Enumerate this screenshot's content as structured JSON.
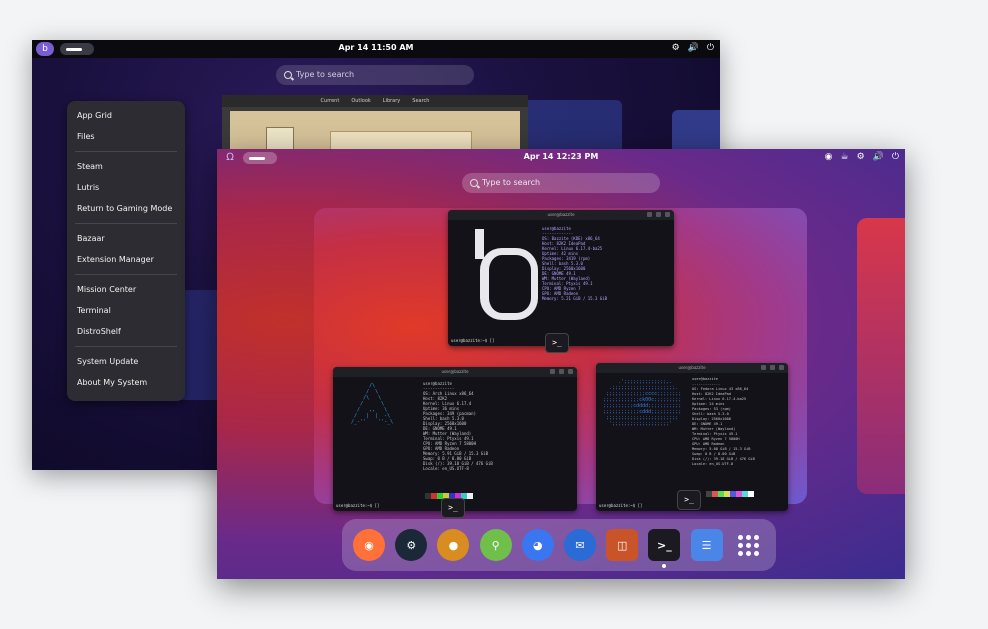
{
  "back": {
    "clock": "Apr 14  11:50 AM",
    "search_placeholder": "Type to search",
    "window_tabs": [
      "Current",
      "Outlook",
      "Library",
      "Search"
    ],
    "menu": [
      {
        "label": "App Grid"
      },
      {
        "label": "Files"
      },
      {
        "sep": true
      },
      {
        "label": "Steam"
      },
      {
        "label": "Lutris"
      },
      {
        "label": "Return to Gaming Mode"
      },
      {
        "sep": true
      },
      {
        "label": "Bazaar"
      },
      {
        "label": "Extension Manager"
      },
      {
        "sep": true
      },
      {
        "label": "Mission Center"
      },
      {
        "label": "Terminal"
      },
      {
        "label": "DistroShelf"
      },
      {
        "sep": true
      },
      {
        "label": "System Update"
      },
      {
        "label": "About My System"
      }
    ]
  },
  "front": {
    "clock": "Apr 14  12:23 PM",
    "search_placeholder": "Type to search",
    "terminals": {
      "top_title": "user@bazzite",
      "left_title": "user@bazzite",
      "right_title": "user@bazzite",
      "prompt": "user@bazzite:~$ []",
      "top_info": "user@bazzite\n-------------\nOS: Bazzite (KDE) x86_64\nHost: 82K2 IdeaPad\nKernel: Linux 6.17.4-ba25\nUptime: 42 mins\nPackages: 3419 (rpm)\nShell: bash 5.3.0\nDisplay: 2560x1600\nDE: GNOME 49.1\nWM: Mutter (Wayland)\nTerminal: Ptyxis 49.1\nCPU: AMD Ryzen 7\nGPU: AMD Radeon\nMemory: 5.21 GiB / 15.3 GiB",
      "left_info": "user@bazzite\n-------------\nOS: Arch Linux x86_64\nHost: 82K2\nKernel: Linux 6.17.4\nUptime: 36 mins\nPackages: 349 (pacman)\nShell: bash 5.3.0\nDisplay: 2560x1600\nDE: GNOME 49.1\nWM: Mutter (Wayland)\nTerminal: Ptyxis 49.1\nCPU: AMD Ryzen 7 5800H\nGPU: AMD Radeon\nMemory: 5.91 GiB / 15.3 GiB\nSwap: 0 B / 8.00 GiB\nDisk (/): 39.18 GiB / 476 GiB\nLocale: en_US.UTF-8",
      "right_info": "user@bazzite\n-------------\nOS: Fedora Linux 43 x86_64\nHost: 82K2 IdeaPad\nKernel: Linux 6.17.4-ba25\nUptime: 24 mins\nPackages: 53 (rpm)\nShell: bash 5.3.0\nDisplay: 2560x1600\nDE: GNOME 49.1\nWM: Mutter (Wayland)\nTerminal: Ptyxis 49.1\nCPU: AMD Ryzen 7 5800H\nGPU: AMD Radeon\nMemory: 5.08 GiB / 15.3 GiB\nSwap: 0 B / 8.00 GiB\nDisk (/): 39.18 GiB / 476 GiB\nLocale: en_US.UTF-8"
    },
    "dock_apps": [
      {
        "name": "firefox-icon",
        "bg": "#ff7139"
      },
      {
        "name": "steam-icon",
        "bg": "#1b2838"
      },
      {
        "name": "lutris-icon",
        "bg": "#d98d20"
      },
      {
        "name": "keepassxc-icon",
        "bg": "#6fbf4a"
      },
      {
        "name": "signal-icon",
        "bg": "#3a76f0"
      },
      {
        "name": "thunderbird-icon",
        "bg": "#2a6bd6"
      },
      {
        "name": "bazaar-icon",
        "bg": "#c9542a"
      },
      {
        "name": "terminal-icon",
        "bg": "#1a1a20"
      },
      {
        "name": "text-editor-icon",
        "bg": "#4a86e8"
      },
      {
        "name": "show-apps-icon",
        "bg": "transparent"
      }
    ]
  }
}
